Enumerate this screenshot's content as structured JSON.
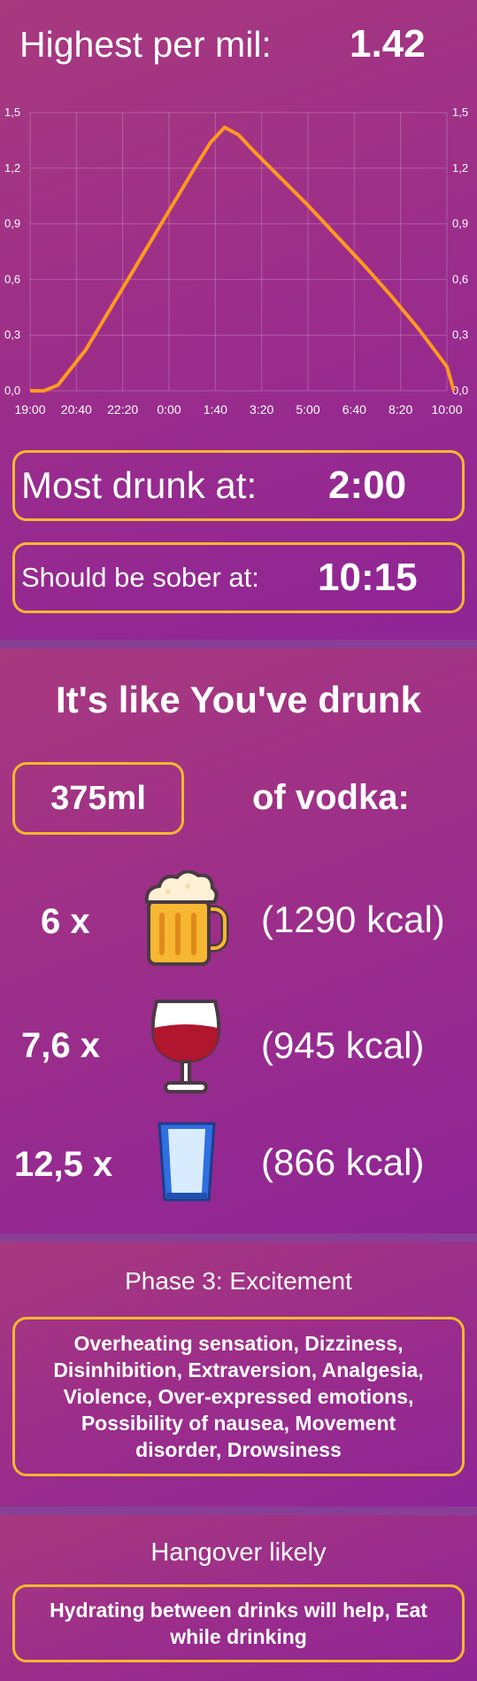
{
  "summary": {
    "highest_label": "Highest per mil:",
    "highest_value": "1.42",
    "most_drunk_label": "Most drunk at:",
    "most_drunk_value": "2:00",
    "sober_label": "Should be sober at:",
    "sober_value": "10:15"
  },
  "chart_data": {
    "type": "line",
    "x_ticks": [
      "19:00",
      "20:40",
      "22:20",
      "0:00",
      "1:40",
      "3:20",
      "5:00",
      "6:40",
      "8:20",
      "10:00"
    ],
    "y_ticks": [
      "0,0",
      "0,3",
      "0,6",
      "0,9",
      "1,2",
      "1,5"
    ],
    "ylim": [
      0,
      1.5
    ],
    "xlim": [
      "19:00",
      "10:00"
    ],
    "grid": true,
    "line_color": "#ff9a1f",
    "series": [
      {
        "x": [
          "19:00",
          "19:30",
          "20:00",
          "21:00",
          "22:00",
          "23:00",
          "0:00",
          "1:00",
          "1:30",
          "2:00",
          "2:30",
          "3:00",
          "4:00",
          "5:00",
          "6:00",
          "7:00",
          "8:00",
          "9:00",
          "10:00",
          "10:15"
        ],
        "y": [
          0.0,
          0.0,
          0.03,
          0.22,
          0.47,
          0.72,
          0.97,
          1.22,
          1.34,
          1.42,
          1.38,
          1.3,
          1.15,
          1.0,
          0.84,
          0.68,
          0.51,
          0.33,
          0.13,
          0.0
        ]
      }
    ]
  },
  "equivalent": {
    "title": "It's like You've drunk",
    "amount": "375ml",
    "of_label": "of vodka:",
    "rows": [
      {
        "count": "6 x",
        "icon": "beer-mug-icon",
        "kcal": "(1290 kcal)"
      },
      {
        "count": "7,6 x",
        "icon": "wine-glass-icon",
        "kcal": "(945 kcal)"
      },
      {
        "count": "12,5 x",
        "icon": "shot-glass-icon",
        "kcal": "(866 kcal)"
      }
    ]
  },
  "phase": {
    "title": "Phase 3: Excitement",
    "description": "Overheating sensation, Dizziness, Disinhibition, Extraversion, Analgesia, Violence, Over-expressed emotions, Possibility of nausea, Movement disorder, Drowsiness"
  },
  "hangover": {
    "title": "Hangover likely",
    "advice": "Hydrating between drinks will help, Eat while drinking"
  },
  "colors": {
    "accent_border": "#f5b82e",
    "chart_line": "#ff9a1f",
    "background": "#9b2f86"
  }
}
